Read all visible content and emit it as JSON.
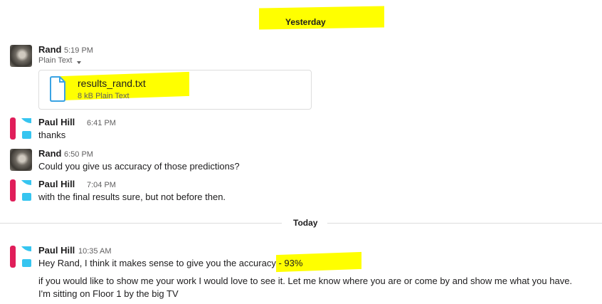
{
  "dividers": {
    "yesterday": "Yesterday",
    "today": "Today"
  },
  "messages": [
    {
      "author": "Rand",
      "time": "5:19 PM",
      "avatar": "rand-photo"
    },
    {
      "author": "Paul Hill",
      "time": "6:41 PM",
      "avatar": "paul-logo",
      "text": "thanks"
    },
    {
      "author": "Rand",
      "time": "6:50 PM",
      "avatar": "rand-photo",
      "text": "Could you give us accuracy of those predictions?"
    },
    {
      "author": "Paul Hill",
      "time": "7:04 PM",
      "avatar": "paul-logo",
      "text": "with the final results sure, but not before then."
    },
    {
      "author": "Paul Hill",
      "time": "10:35 AM",
      "avatar": "paul-logo",
      "text": "Hey Rand, I think it makes sense to give you the accuracy - 93%"
    }
  ],
  "snippet": {
    "type_label": "Plain Text",
    "dropdown_icon": "caret-down-icon",
    "file_icon": "document-icon",
    "file_name": "results_rand.txt",
    "file_meta": "8 kB Plain Text"
  },
  "continuation": {
    "line1": "if you would like to show me your work I would love to see it.  Let me know where you are or come by and show me what you have.",
    "line2": "I'm sitting on Floor 1 by the big TV"
  },
  "colors": {
    "highlight": "#ffff00",
    "paul_red": "#e01e5a",
    "paul_blue": "#36c5f0"
  }
}
